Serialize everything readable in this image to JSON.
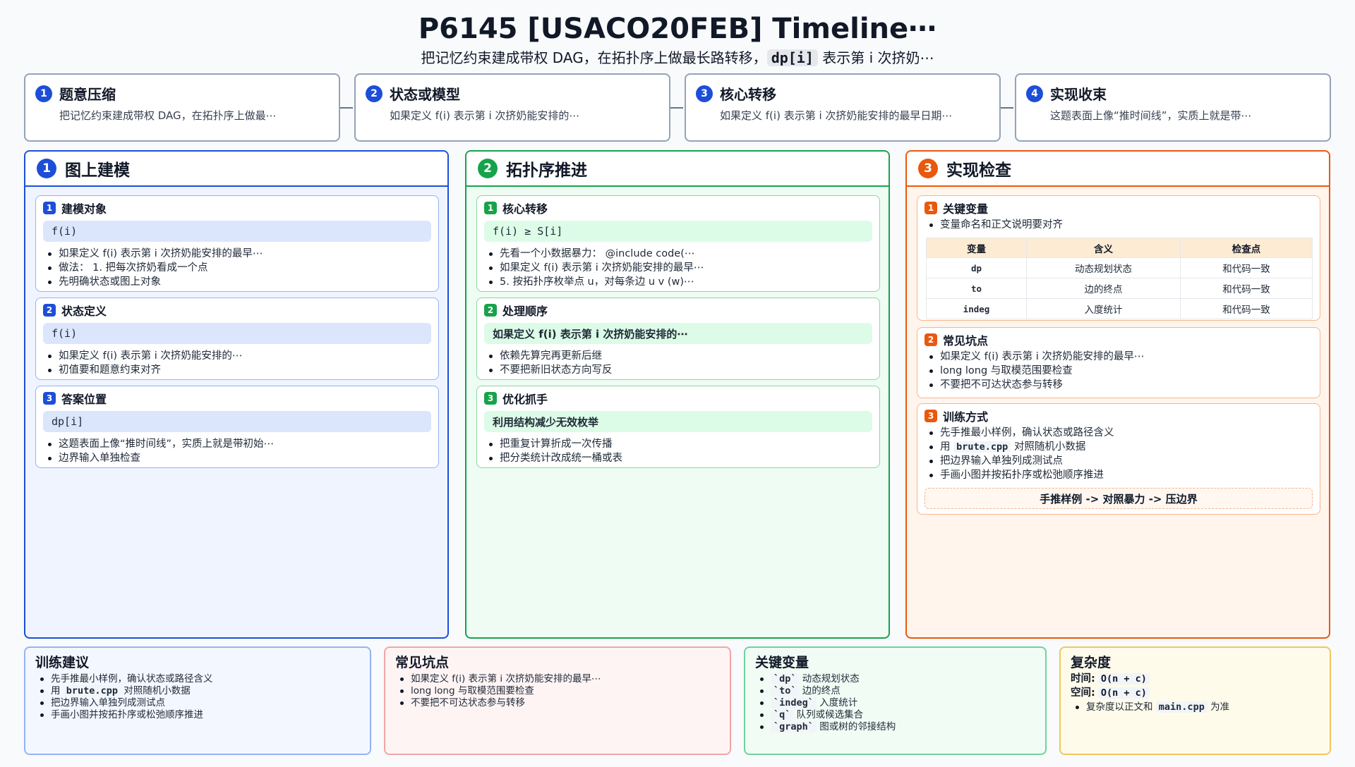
{
  "header": {
    "title": "P6145 [USACO20FEB] Timeline⋯",
    "subtitle_pre": "把记忆约束建成带权 DAG，在拓扑序上做最长路转移，",
    "subtitle_code": "dp[i]",
    "subtitle_post": " 表示第 i 次挤奶⋯"
  },
  "steps": [
    {
      "num": "1",
      "title": "题意压缩",
      "text": "把记忆约束建成带权 DAG，在拓扑序上做最⋯"
    },
    {
      "num": "2",
      "title": "状态或模型",
      "text": "如果定义 f(i) 表示第 i 次挤奶能安排的⋯"
    },
    {
      "num": "3",
      "title": "核心转移",
      "text": "如果定义 f(i) 表示第 i 次挤奶能安排的最早日期⋯"
    },
    {
      "num": "4",
      "title": "实现收束",
      "text": "这题表面上像“推时间线”，实质上就是带⋯"
    }
  ],
  "columns": {
    "c1": {
      "num": "1",
      "title": "图上建模",
      "cards": [
        {
          "num": "1",
          "title": "建模对象",
          "bar": "f(i)",
          "bullets": [
            "如果定义 f(i) 表示第 i 次挤奶能安排的最早⋯",
            "做法： 1. 把每次挤奶看成一个点",
            "先明确状态或图上对象"
          ]
        },
        {
          "num": "2",
          "title": "状态定义",
          "bar": "f(i)",
          "bullets": [
            "如果定义 f(i) 表示第 i 次挤奶能安排的⋯",
            "初值要和题意约束对齐"
          ]
        },
        {
          "num": "3",
          "title": "答案位置",
          "bar": "dp[i]",
          "bullets": [
            "这题表面上像“推时间线”，实质上就是带初始⋯",
            "边界输入单独检查"
          ]
        }
      ]
    },
    "c2": {
      "num": "2",
      "title": "拓扑序推进",
      "cards": [
        {
          "num": "1",
          "title": "核心转移",
          "bar": "f(i) ≥ S[i]",
          "bullets": [
            "先看一个小数据暴力： @include code(⋯",
            "如果定义 f(i) 表示第 i 次挤奶能安排的最早⋯",
            "5. 按拓扑序枚举点 u，对每条边 u v (w)⋯"
          ]
        },
        {
          "num": "2",
          "title": "处理顺序",
          "bar": "如果定义 f(i) 表示第 i 次挤奶能安排的⋯",
          "bullets": [
            "依赖先算完再更新后继",
            "不要把新旧状态方向写反"
          ]
        },
        {
          "num": "3",
          "title": "优化抓手",
          "bar": "利用结构减少无效枚举",
          "bullets": [
            "把重复计算折成一次传播",
            "把分类统计改成统一桶或表"
          ]
        }
      ]
    },
    "c3": {
      "num": "3",
      "title": "实现检查",
      "card1": {
        "num": "1",
        "title": "关键变量",
        "bullets": [
          "变量命名和正文说明要对齐"
        ],
        "table": {
          "headers": [
            "变量",
            "含义",
            "检查点"
          ],
          "rows": [
            [
              "dp",
              "动态规划状态",
              "和代码一致"
            ],
            [
              "to",
              "边的终点",
              "和代码一致"
            ],
            [
              "indeg",
              "入度统计",
              "和代码一致"
            ]
          ]
        }
      },
      "card2": {
        "num": "2",
        "title": "常见坑点",
        "bullets": [
          "如果定义 f(i) 表示第 i 次挤奶能安排的最早⋯",
          "long long 与取模范围要检查",
          "不要把不可达状态参与转移"
        ]
      },
      "card3": {
        "num": "3",
        "title": "训练方式",
        "b1": "先手推最小样例，确认状态或路径含义",
        "b2_pre": "用 ",
        "b2_code": "brute.cpp",
        "b2_post": " 对照随机小数据",
        "b3": "把边界输入单独列成测试点",
        "b4": "手画小图并按拓扑序或松弛顺序推进",
        "flow": "手推样例 -> 对照暴力 -> 压边界"
      }
    }
  },
  "bottom": {
    "training": {
      "title": "训练建议",
      "b1": "先手推最小样例，确认状态或路径含义",
      "b2_pre": "用 ",
      "b2_code": "brute.cpp",
      "b2_post": " 对照随机小数据",
      "b3": "把边界输入单独列成测试点",
      "b4": "手画小图并按拓扑序或松弛顺序推进"
    },
    "pitfalls": {
      "title": "常见坑点",
      "bullets": [
        "如果定义 f(i) 表示第 i 次挤奶能安排的最早⋯",
        "long long 与取模范围要检查",
        "不要把不可达状态参与转移"
      ]
    },
    "variables": {
      "title": "关键变量",
      "items": [
        {
          "code": "`dp`",
          "desc": " 动态规划状态"
        },
        {
          "code": "`to`",
          "desc": " 边的终点"
        },
        {
          "code": "`indeg`",
          "desc": " 入度统计"
        },
        {
          "code": "`q`",
          "desc": " 队列或候选集合"
        },
        {
          "code": "`graph`",
          "desc": " 图或树的邻接结构"
        }
      ]
    },
    "complexity": {
      "title": "复杂度",
      "time_label": "时间:",
      "time_code": "O(n + c)",
      "space_label": "空间:",
      "space_code": "O(n + c)",
      "note_pre": "复杂度以正文和 ",
      "note_code": "main.cpp",
      "note_post": " 为准"
    }
  }
}
